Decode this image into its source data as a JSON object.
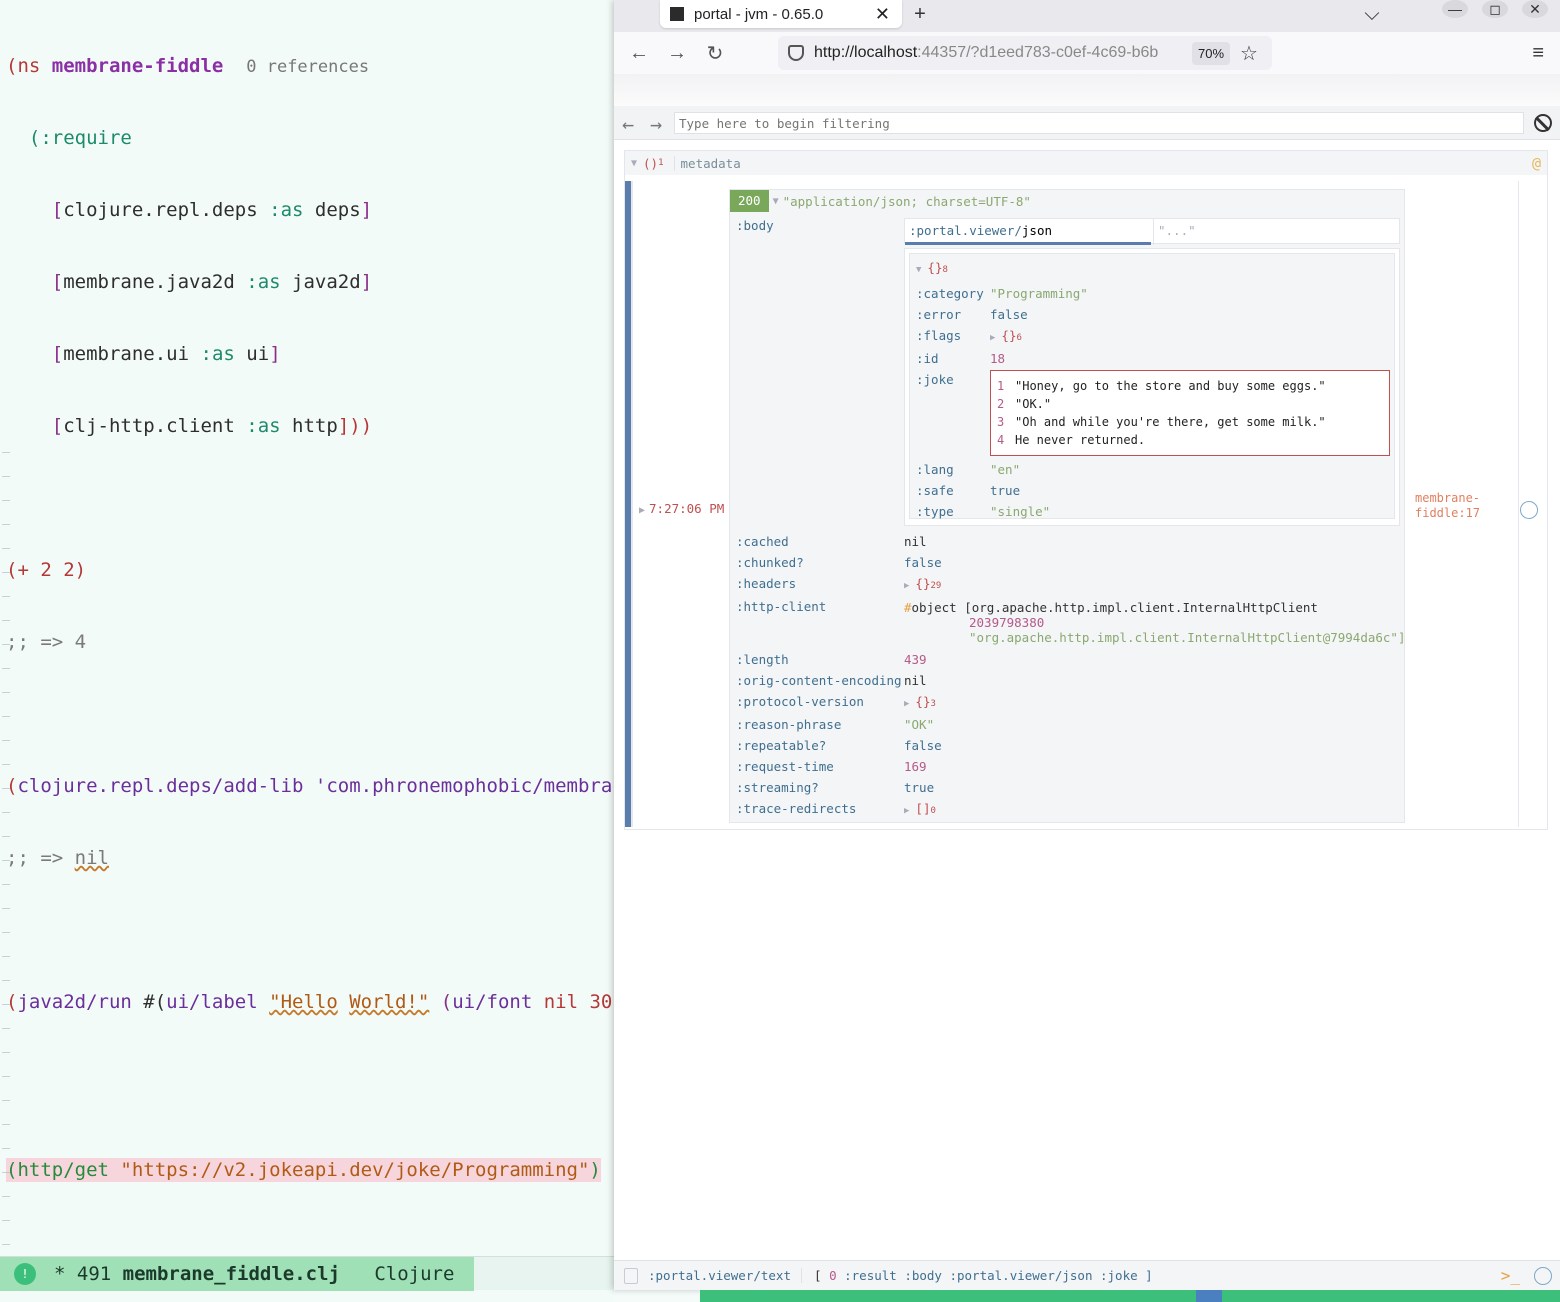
{
  "editor": {
    "ns_line": {
      "open": "(ns ",
      "name": "membrane-fiddle",
      "refs": "0 references"
    },
    "require": "(:require",
    "deps": [
      {
        "name": "clojure.repl.deps",
        "as": ":as",
        "alias": "deps"
      },
      {
        "name": "membrane.java2d",
        "as": ":as",
        "alias": "java2d"
      },
      {
        "name": "membrane.ui",
        "as": ":as",
        "alias": "ui"
      },
      {
        "name": "clj-http.client",
        "as": ":as",
        "alias": "http",
        "close": "]))"
      }
    ],
    "plus_expr": "(+ 2 2)",
    "plus_result": ";; => 4",
    "addlib_fn": "clojure.repl.deps/add-lib",
    "addlib_arg": "'com.phronemophobic/membra",
    "addlib_result_prefix": ";; => ",
    "addlib_result_val": "nil",
    "run_fn": "java2d/run",
    "run_hash": " #(",
    "run_label_fn": "ui/label",
    "run_str_a": "\"Hello",
    "run_str_b": "World!\"",
    "run_font_fn": "ui/font",
    "run_font_rest": " nil 30",
    "http_fn": "http/get",
    "http_url": "\"https://v2.jokeapi.dev/joke/Programming\"",
    "modeline": {
      "indicator": "!",
      "status": "* 491 ",
      "file": "membrane_fiddle.clj",
      "mode": "Clojure"
    }
  },
  "browser": {
    "tab_title": "portal - jvm - 0.65.0",
    "tab_close": "✕",
    "new_tab": "+",
    "tabs_dropdown": "⌵",
    "win_min": "—",
    "win_max": "◻",
    "win_close": "✕",
    "url_host": "http://localhost",
    "url_rest": ":44357/?d1eed783-c0ef-4c69-b6b",
    "zoom": "70%",
    "back": "←",
    "forward": "→",
    "reload": "↻",
    "star": "☆",
    "menu": "≡"
  },
  "portal": {
    "filter_placeholder": "Type here to begin filtering",
    "filter_back": "←",
    "filter_fwd": "→",
    "meta": {
      "coll": "()",
      "count": "1",
      "label": "metadata",
      "at": "@"
    },
    "time": "7:27:06 PM",
    "source": "membrane-fiddle:17",
    "status": "200",
    "content_type": "\"application/json; charset=UTF-8\"",
    "body_key": ":body",
    "viewer_ns": ":portal.viewer/",
    "viewer_name": "json",
    "viewer_other": "\"...\"",
    "json_map": {
      "coll": "{}",
      "count": "8"
    },
    "json_rows": [
      {
        "k": ":category",
        "v": "\"Programming\"",
        "t": "s"
      },
      {
        "k": ":error",
        "v": "false",
        "t": "b"
      },
      {
        "k": ":flags",
        "v": "{}",
        "c": "6",
        "t": "coll"
      },
      {
        "k": ":id",
        "v": "18",
        "t": "n"
      },
      {
        "k": ":joke",
        "v": "",
        "t": "joke"
      },
      {
        "k": ":lang",
        "v": "\"en\"",
        "t": "s"
      },
      {
        "k": ":safe",
        "v": "true",
        "t": "b"
      },
      {
        "k": ":type",
        "v": "\"single\"",
        "t": "s"
      }
    ],
    "joke_lines": [
      {
        "i": "1",
        "text": "\"Honey, go to the store and buy some eggs.\""
      },
      {
        "i": "2",
        "text": "\"OK.\""
      },
      {
        "i": "3",
        "text": "\"Oh and while you're there, get some milk.\""
      },
      {
        "i": "4",
        "text": "He never returned."
      }
    ],
    "resp_rows": [
      {
        "k": ":cached",
        "v": "nil",
        "t": "nil"
      },
      {
        "k": ":chunked?",
        "v": "false",
        "t": "b"
      },
      {
        "k": ":headers",
        "v": "{}",
        "c": "29",
        "t": "coll"
      },
      {
        "k": ":http-client",
        "v": "",
        "t": "obj"
      },
      {
        "k": ":length",
        "v": "439",
        "t": "n"
      },
      {
        "k": ":orig-content-encoding",
        "v": "nil",
        "t": "nil"
      },
      {
        "k": ":protocol-version",
        "v": "{}",
        "c": "3",
        "t": "coll"
      },
      {
        "k": ":reason-phrase",
        "v": "\"OK\"",
        "t": "s"
      },
      {
        "k": ":repeatable?",
        "v": "false",
        "t": "b"
      },
      {
        "k": ":request-time",
        "v": "169",
        "t": "n"
      },
      {
        "k": ":streaming?",
        "v": "true",
        "t": "b"
      },
      {
        "k": ":trace-redirects",
        "v": "[]",
        "c": "0",
        "t": "coll"
      }
    ],
    "http_client": {
      "tag": "#",
      "obj": "object [org.apache.http.impl.client.InternalHttpClient",
      "id": "2039798380",
      "str": "\"org.apache.http.impl.client.InternalHttpClient@7994da6c\"]"
    },
    "footer": {
      "viewer": ":portal.viewer/text",
      "open": "[ ",
      "idx": "0",
      "p1": " :result :body ",
      "p2": ":portal.viewer/json",
      "p3": " :joke ]",
      "prompt": ">_"
    }
  }
}
